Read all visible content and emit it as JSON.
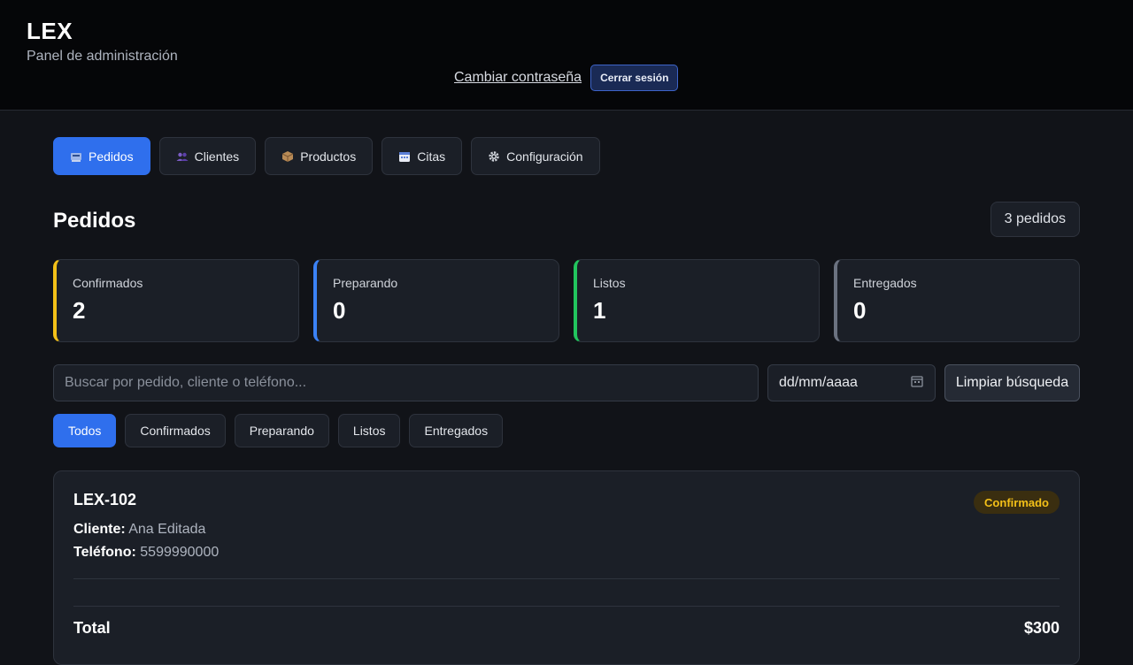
{
  "header": {
    "brand": "LEX",
    "subtitle": "Panel de administración",
    "change_password": "Cambiar contraseña",
    "logout": "Cerrar sesión"
  },
  "tabs": [
    {
      "label": "Pedidos",
      "icon": "cash-register-icon",
      "active": true
    },
    {
      "label": "Clientes",
      "icon": "users-icon",
      "active": false
    },
    {
      "label": "Productos",
      "icon": "package-icon",
      "active": false
    },
    {
      "label": "Citas",
      "icon": "calendar-icon",
      "active": false
    },
    {
      "label": "Configuración",
      "icon": "gear-icon",
      "active": false
    }
  ],
  "section": {
    "title": "Pedidos",
    "count_badge": "3 pedidos"
  },
  "stats": [
    {
      "label": "Confirmados",
      "value": "2",
      "color": "#f3c018"
    },
    {
      "label": "Preparando",
      "value": "0",
      "color": "#3b82f6"
    },
    {
      "label": "Listos",
      "value": "1",
      "color": "#22c55e"
    },
    {
      "label": "Entregados",
      "value": "0",
      "color": "#6b7280"
    }
  ],
  "search": {
    "placeholder": "Buscar por pedido, cliente o teléfono...",
    "date_placeholder": "dd/mm/aaaa",
    "clear_label": "Limpiar búsqueda"
  },
  "filters": [
    {
      "label": "Todos",
      "active": true
    },
    {
      "label": "Confirmados",
      "active": false
    },
    {
      "label": "Preparando",
      "active": false
    },
    {
      "label": "Listos",
      "active": false
    },
    {
      "label": "Entregados",
      "active": false
    }
  ],
  "order": {
    "id": "LEX-102",
    "status": "Confirmado",
    "client_label": "Cliente:",
    "client": "Ana Editada",
    "phone_label": "Teléfono:",
    "phone": "5599990000",
    "total_label": "Total",
    "total": "$300"
  },
  "colors": {
    "accent": "#2f6fed",
    "status_confirmed_text": "#f3c018",
    "status_confirmed_bg": "#3a2e10"
  }
}
